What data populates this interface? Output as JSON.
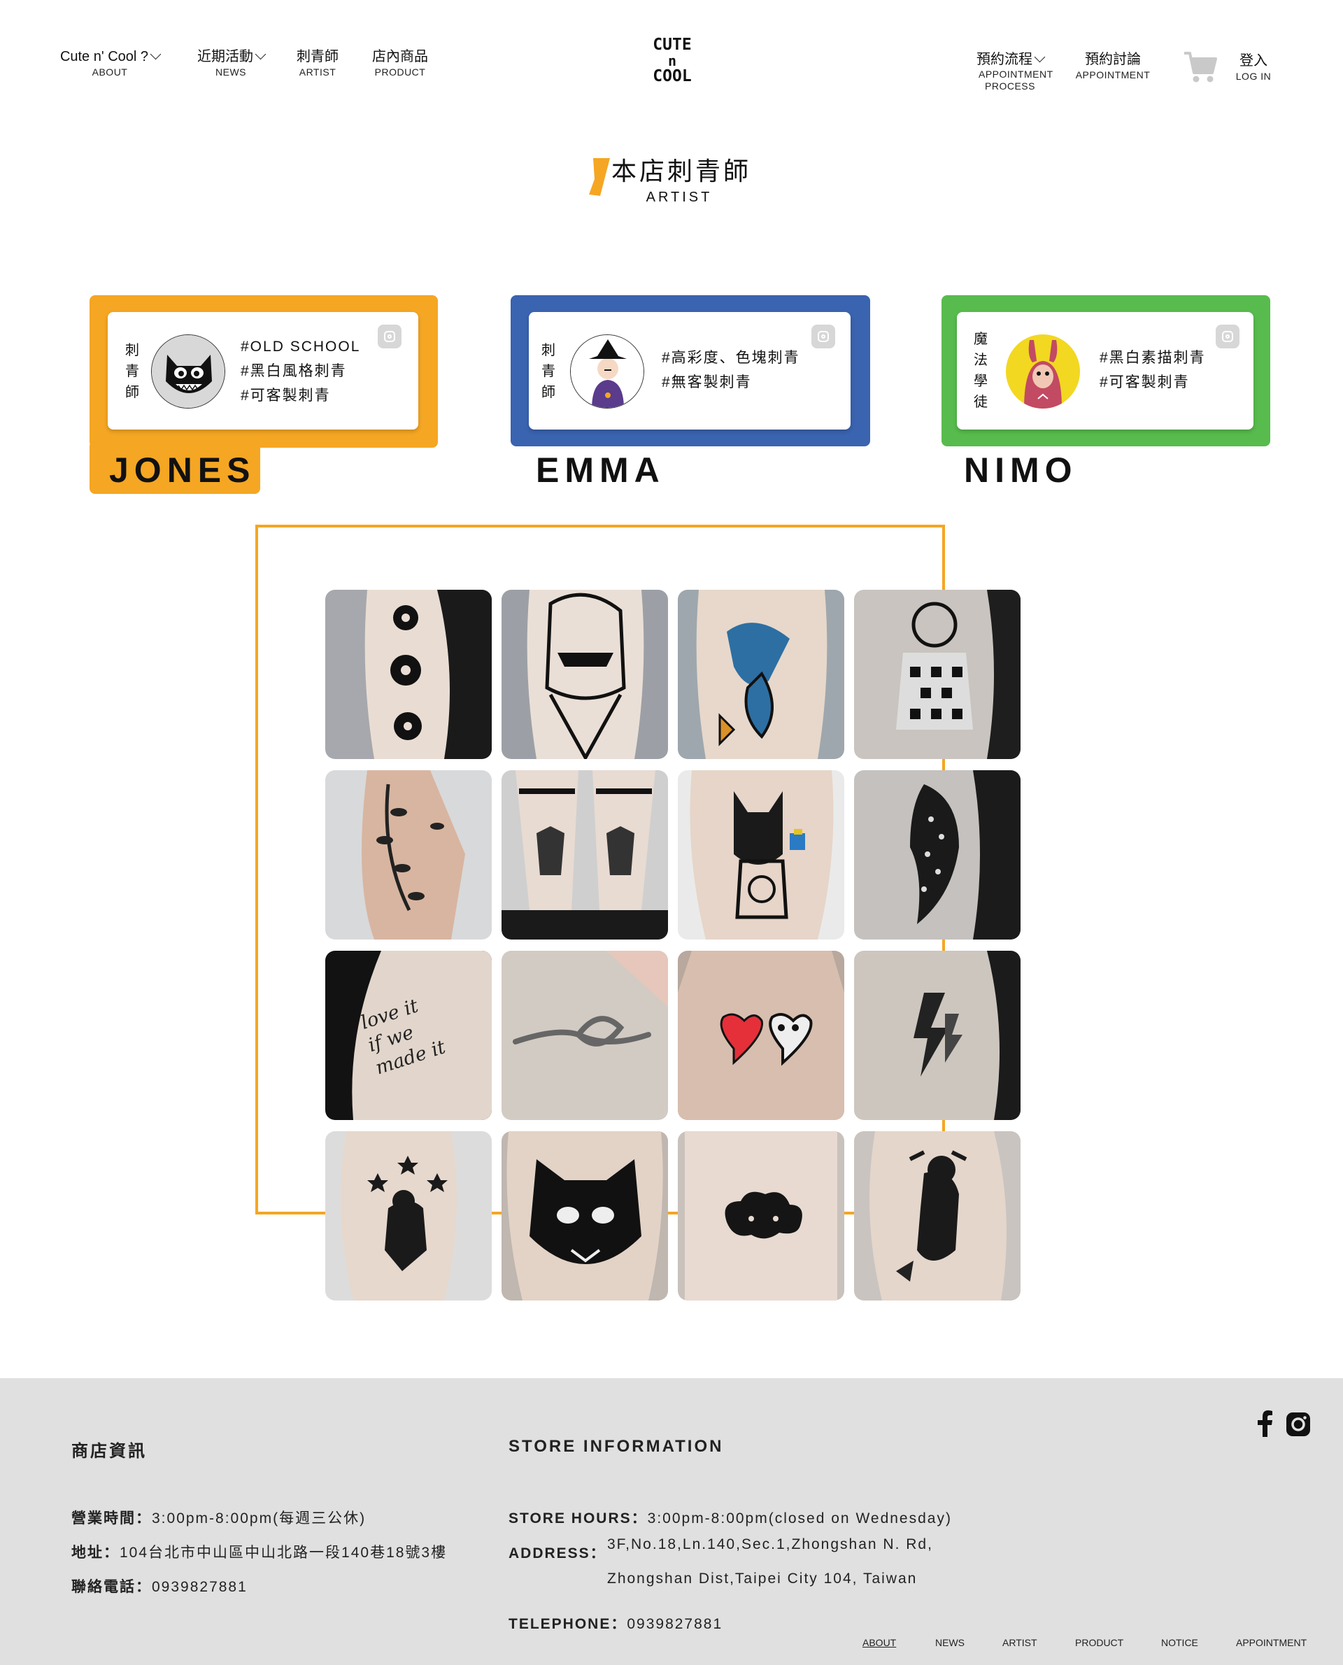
{
  "header": {
    "nav_left": [
      {
        "label": "Cute n' Cool ?",
        "sub": "ABOUT"
      },
      {
        "label": "近期活動",
        "sub": "NEWS"
      },
      {
        "label": "刺青師",
        "sub": "ARTIST"
      },
      {
        "label": "店內商品",
        "sub": "PRODUCT"
      }
    ],
    "logo_lines": [
      "CUTE",
      "n",
      "COOL"
    ],
    "nav_right": [
      {
        "label": "預約流程",
        "sub": "APPOINTMENT PROCESS"
      },
      {
        "label": "預約討論",
        "sub": "APPOINTMENT"
      }
    ],
    "login": {
      "label": "登入",
      "sub": "LOG IN"
    },
    "icons": {
      "cart": "cart-icon",
      "dropdown": "chevron-down-icon"
    }
  },
  "section": {
    "title_zh": "本店刺青師",
    "title_en": "ARTIST",
    "accent": "#f5a623"
  },
  "artists": [
    {
      "name": "JONES",
      "role": [
        "刺",
        "青",
        "師"
      ],
      "tags": [
        "#OLD SCHOOL",
        "#黑白風格刺青",
        "#可客製刺青"
      ],
      "color": "#f5a623",
      "active": true
    },
    {
      "name": "EMMA",
      "role": [
        "刺",
        "青",
        "師"
      ],
      "tags": [
        "#高彩度、色塊刺青",
        "#無客製刺青"
      ],
      "color": "#3a63b0",
      "active": false
    },
    {
      "name": "NIMO",
      "role": [
        "魔",
        "法",
        "學",
        "徒"
      ],
      "tags": [
        "#黑白素描刺青",
        "#可客製刺青"
      ],
      "color": "#58bb4d",
      "active": false
    }
  ],
  "gallery": {
    "frame_color": "#f5a623",
    "items": [
      {
        "alt": "flower-tattoos"
      },
      {
        "alt": "scarf-lady-tattoo"
      },
      {
        "alt": "swallow-tattoo"
      },
      {
        "alt": "clown-doll-tattoo"
      },
      {
        "alt": "botanical-arm-tattoo"
      },
      {
        "alt": "legs-bat-tattoos"
      },
      {
        "alt": "fox-money-tattoo"
      },
      {
        "alt": "whale-shark-tattoo"
      },
      {
        "alt": "script-tattoo"
      },
      {
        "alt": "knot-tattoo"
      },
      {
        "alt": "hearts-tattoo"
      },
      {
        "alt": "lightning-tattoo"
      },
      {
        "alt": "juggling-cat-tattoo"
      },
      {
        "alt": "panther-tattoo"
      },
      {
        "alt": "cloud-tattoo"
      },
      {
        "alt": "climbing-cat-tattoo"
      }
    ],
    "script_text": [
      "love it",
      "if we",
      "made it"
    ]
  },
  "footer": {
    "heading_zh": "商店資訊",
    "heading_en": "STORE INFORMATION",
    "hours_zh_label": "營業時間：",
    "hours_zh": "3:00pm-8:00pm(每週三公休)",
    "address_zh_label": "地址：",
    "address_zh": "104台北市中山區中山北路一段140巷18號3樓",
    "phone_zh_label": "聯絡電話：",
    "phone_zh": "0939827881",
    "hours_en_label": "STORE HOURS：",
    "hours_en": "3:00pm-8:00pm(closed on Wednesday)",
    "address_en_label": "ADDRESS：",
    "address_en_1": "3F,No.18,Ln.140,Sec.1,Zhongshan N. Rd,",
    "address_en_2": "Zhongshan Dist,Taipei City 104, Taiwan",
    "phone_en_label": "TELEPHONE：",
    "phone_en": "0939827881",
    "links": [
      "ABOUT",
      "NEWS",
      "ARTIST",
      "PRODUCT",
      "NOTICE",
      "APPOINTMENT"
    ],
    "active_link": "ABOUT",
    "social_icons": [
      "facebook-icon",
      "instagram-icon"
    ]
  }
}
